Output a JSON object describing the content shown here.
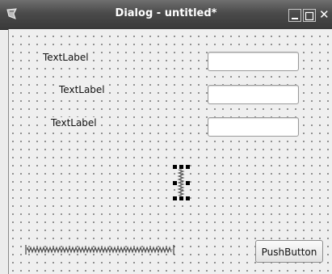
{
  "window": {
    "title": "Dialog - untitled*",
    "close_glyph": "✕"
  },
  "form": {
    "labels": [
      "TextLabel",
      "TextLabel",
      "TextLabel"
    ],
    "line_edits": [
      "",
      "",
      ""
    ],
    "push_button": "PushButton"
  },
  "icons": {
    "app": "designer-app-icon",
    "minimize": "minimize-icon",
    "maximize": "maximize-icon",
    "close": "close-icon"
  },
  "colors": {
    "titlebar": "#4a4a4a",
    "client_background": "#efefef",
    "grid_dot": "#3c3c3c",
    "selection_handle": "#000000"
  }
}
